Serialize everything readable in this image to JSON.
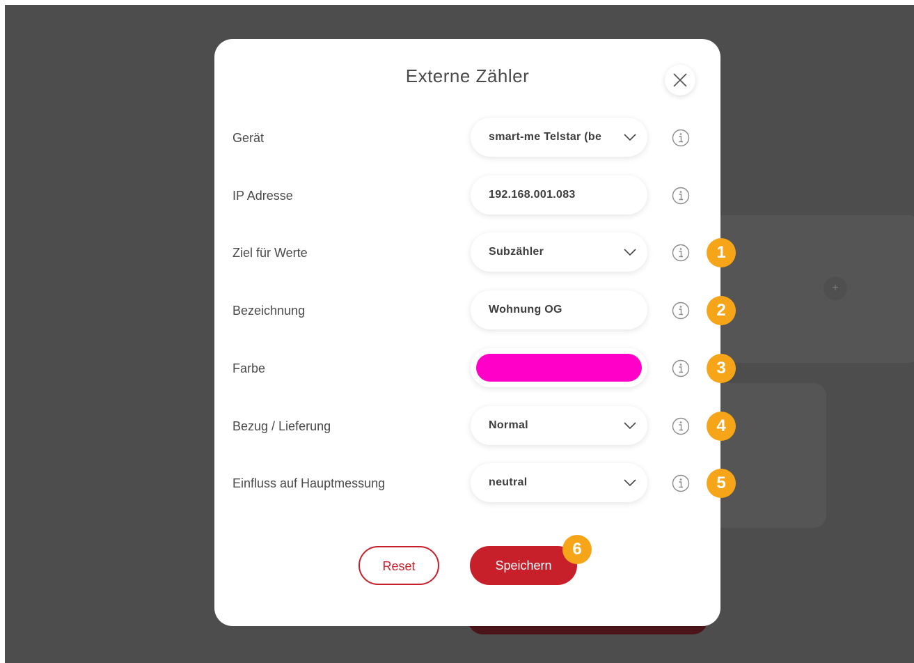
{
  "modal": {
    "title": "Externe Zähler",
    "close_icon": "close-icon"
  },
  "fields": [
    {
      "label": "Gerät",
      "value": "smart-me Telstar (be",
      "type": "select",
      "badge": null
    },
    {
      "label": "IP Adresse",
      "value": "192.168.001.083",
      "type": "input",
      "badge": null
    },
    {
      "label": "Ziel für Werte",
      "value": "Subzähler",
      "type": "select",
      "badge": "1"
    },
    {
      "label": "Bezeichnung",
      "value": "Wohnung OG",
      "type": "input",
      "badge": "2"
    },
    {
      "label": "Farbe",
      "value": "#ff00c8",
      "type": "color",
      "badge": "3"
    },
    {
      "label": "Bezug / Lieferung",
      "value": "Normal",
      "type": "select",
      "badge": "4"
    },
    {
      "label": "Einfluss auf Hauptmessung",
      "value": "neutral",
      "type": "select",
      "badge": "5"
    }
  ],
  "actions": {
    "reset_label": "Reset",
    "save_label": "Speichern",
    "save_badge": "6"
  },
  "background": {
    "plus_label": "+"
  },
  "colors": {
    "accent": "#c8202b",
    "badge": "#f7a518",
    "backdrop": "#4d4d4d",
    "swatch": "#ff00c8"
  }
}
